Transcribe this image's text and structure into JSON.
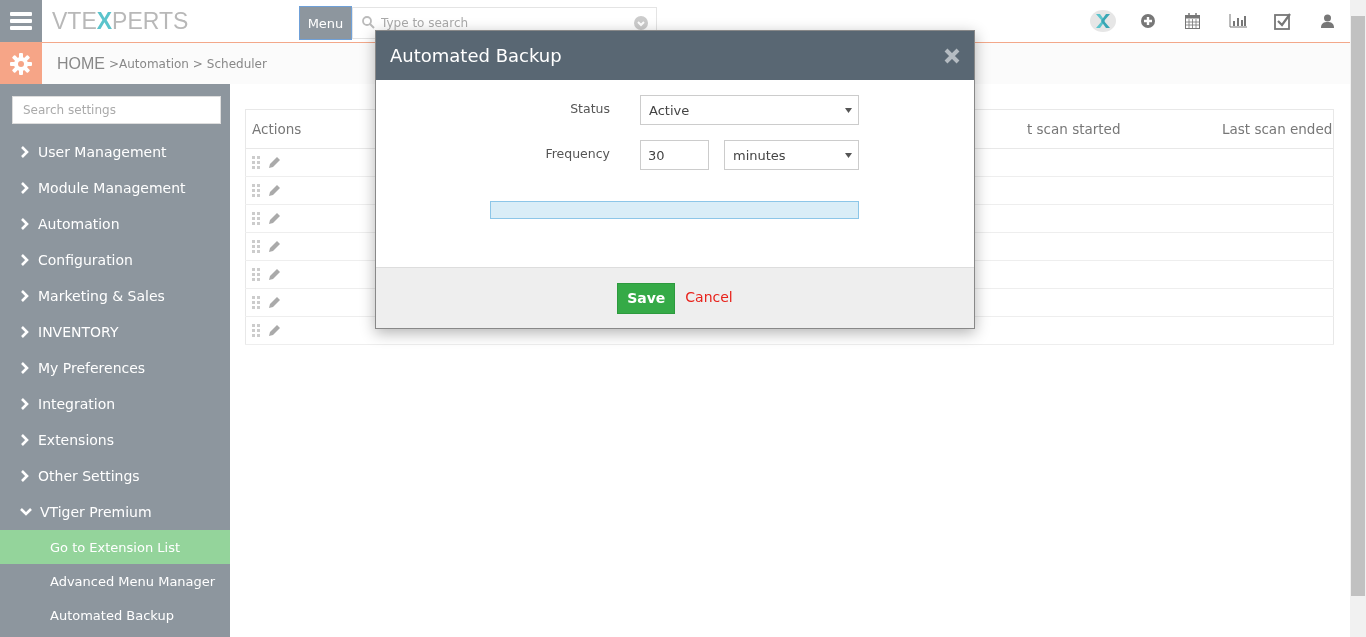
{
  "header": {
    "logo": "VTE**X**PERTS",
    "menu_button": "Menu",
    "search": {
      "placeholder": "Type to search"
    }
  },
  "breadcrumb": {
    "home": "HOME",
    "items": [
      ">Automation >",
      "Scheduler"
    ]
  },
  "sidebar": {
    "search": {
      "placeholder": "Search settings"
    },
    "items": [
      {
        "label": "User Management",
        "expanded": false
      },
      {
        "label": "Module Management",
        "expanded": false
      },
      {
        "label": "Automation",
        "expanded": false
      },
      {
        "label": "Configuration",
        "expanded": false
      },
      {
        "label": "Marketing & Sales",
        "expanded": false
      },
      {
        "label": "INVENTORY",
        "expanded": false
      },
      {
        "label": "My Preferences",
        "expanded": false
      },
      {
        "label": "Integration",
        "expanded": false
      },
      {
        "label": "Extensions",
        "expanded": false
      },
      {
        "label": "Other Settings",
        "expanded": false
      },
      {
        "label": "VTiger Premium",
        "expanded": true,
        "children": [
          {
            "label": "Go to Extension List",
            "selected": true
          },
          {
            "label": "Advanced Menu Manager",
            "selected": false
          },
          {
            "label": "Automated Backup",
            "selected": false
          }
        ]
      }
    ]
  },
  "table": {
    "columns": [
      "Actions",
      "",
      "",
      "",
      "",
      "t scan started",
      "Last scan ended"
    ],
    "rows": [
      [
        "",
        "",
        "",
        "",
        "",
        "",
        ""
      ],
      [
        "",
        "",
        "",
        "",
        "",
        "",
        ""
      ],
      [
        "",
        "",
        "",
        "",
        "",
        "",
        ""
      ],
      [
        "",
        "",
        "",
        "",
        "",
        "",
        ""
      ],
      [
        "",
        "",
        "",
        "",
        "",
        "",
        ""
      ],
      [
        "",
        "",
        "",
        "",
        "",
        "",
        ""
      ],
      [
        "",
        "",
        "",
        "",
        "",
        "",
        ""
      ]
    ]
  },
  "modal": {
    "title": "Automated Backup",
    "fields": [
      {
        "kind": "select",
        "label": "Status",
        "value": "Active"
      },
      {
        "kind": "number_unit",
        "label": "Frequency",
        "value": "30",
        "unit": "minutes"
      }
    ],
    "save": "Save",
    "cancel": "Cancel"
  }
}
